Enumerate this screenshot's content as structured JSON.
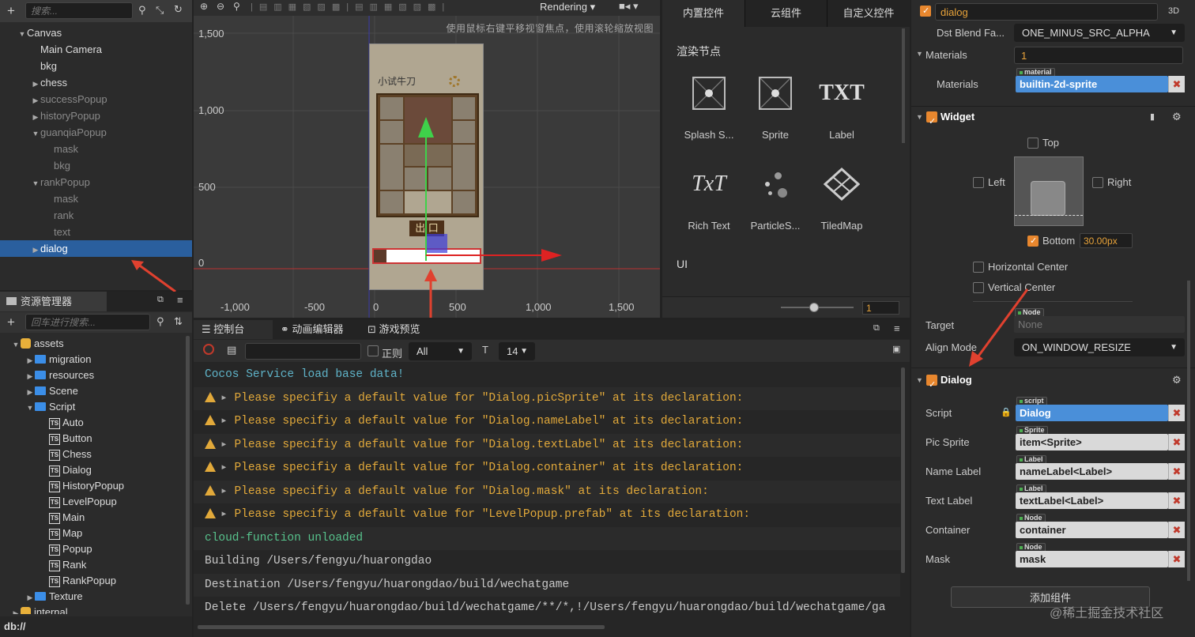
{
  "hierarchy": {
    "search_placeholder": "搜索...",
    "nodes": [
      {
        "label": "Canvas",
        "arrow": "▼",
        "indent": 0,
        "dim": false,
        "sel": false
      },
      {
        "label": "Main Camera",
        "arrow": "",
        "indent": 1,
        "dim": false,
        "sel": false
      },
      {
        "label": "bkg",
        "arrow": "",
        "indent": 1,
        "dim": false,
        "sel": false
      },
      {
        "label": "chess",
        "arrow": "▶",
        "indent": 1,
        "dim": false,
        "sel": false
      },
      {
        "label": "successPopup",
        "arrow": "▶",
        "indent": 1,
        "dim": true,
        "sel": false
      },
      {
        "label": "historyPopup",
        "arrow": "▶",
        "indent": 1,
        "dim": true,
        "sel": false
      },
      {
        "label": "guanqiaPopup",
        "arrow": "▼",
        "indent": 1,
        "dim": true,
        "sel": false
      },
      {
        "label": "mask",
        "arrow": "",
        "indent": 2,
        "dim": true,
        "sel": false
      },
      {
        "label": "bkg",
        "arrow": "",
        "indent": 2,
        "dim": true,
        "sel": false
      },
      {
        "label": "rankPopup",
        "arrow": "▼",
        "indent": 1,
        "dim": true,
        "sel": false
      },
      {
        "label": "mask",
        "arrow": "",
        "indent": 2,
        "dim": true,
        "sel": false
      },
      {
        "label": "rank",
        "arrow": "",
        "indent": 2,
        "dim": true,
        "sel": false
      },
      {
        "label": "text",
        "arrow": "",
        "indent": 2,
        "dim": true,
        "sel": false
      },
      {
        "label": "dialog",
        "arrow": "▶",
        "indent": 1,
        "dim": false,
        "sel": true
      }
    ]
  },
  "assets": {
    "title": "资源管理器",
    "search_placeholder": "回车进行搜索...",
    "items": [
      {
        "label": "assets",
        "kind": "db",
        "arrow": "▼",
        "indent": 0
      },
      {
        "label": "migration",
        "kind": "folder",
        "arrow": "▶",
        "indent": 1
      },
      {
        "label": "resources",
        "kind": "folder",
        "arrow": "▶",
        "indent": 1
      },
      {
        "label": "Scene",
        "kind": "folder",
        "arrow": "▶",
        "indent": 1
      },
      {
        "label": "Script",
        "kind": "folder",
        "arrow": "▼",
        "indent": 1
      },
      {
        "label": "Auto",
        "kind": "ts",
        "arrow": "",
        "indent": 2
      },
      {
        "label": "Button",
        "kind": "ts",
        "arrow": "",
        "indent": 2
      },
      {
        "label": "Chess",
        "kind": "ts",
        "arrow": "",
        "indent": 2
      },
      {
        "label": "Dialog",
        "kind": "ts",
        "arrow": "",
        "indent": 2
      },
      {
        "label": "HistoryPopup",
        "kind": "ts",
        "arrow": "",
        "indent": 2
      },
      {
        "label": "LevelPopup",
        "kind": "ts",
        "arrow": "",
        "indent": 2
      },
      {
        "label": "Main",
        "kind": "ts",
        "arrow": "",
        "indent": 2
      },
      {
        "label": "Map",
        "kind": "ts",
        "arrow": "",
        "indent": 2
      },
      {
        "label": "Popup",
        "kind": "ts",
        "arrow": "",
        "indent": 2
      },
      {
        "label": "Rank",
        "kind": "ts",
        "arrow": "",
        "indent": 2
      },
      {
        "label": "RankPopup",
        "kind": "ts",
        "arrow": "",
        "indent": 2
      },
      {
        "label": "Texture",
        "kind": "folder",
        "arrow": "▶",
        "indent": 1
      },
      {
        "label": "internal",
        "kind": "db",
        "arrow": "▶",
        "indent": 0
      }
    ],
    "status": "db://"
  },
  "scene": {
    "rendering": "Rendering",
    "hint": "使用鼠标右键平移视窗焦点，使用滚轮缩放视图",
    "y_labels": [
      "1,500",
      "1,000",
      "500",
      "0"
    ],
    "x_labels": [
      "-1,000",
      "-500",
      "0",
      "500",
      "1,000",
      "1,500"
    ],
    "game_title": "小试牛刀",
    "exit_label": "出 口"
  },
  "controls": {
    "tabs": [
      "内置控件",
      "云组件",
      "自定义控件"
    ],
    "section": "渲染节点",
    "section2": "UI",
    "items": [
      {
        "label": "Splash S...",
        "icon": "sprite"
      },
      {
        "label": "Sprite",
        "icon": "sprite"
      },
      {
        "label": "Label",
        "icon": "TXT"
      },
      {
        "label": "Rich Text",
        "icon": "TxT"
      },
      {
        "label": "ParticleS...",
        "icon": "particle"
      },
      {
        "label": "TiledMap",
        "icon": "tiled"
      }
    ],
    "zoom_value": "1"
  },
  "console": {
    "tabs": [
      "控制台",
      "动画编辑器",
      "游戏预览"
    ],
    "regex_label": "正则",
    "level": "All",
    "font_size": "14",
    "lines": [
      {
        "type": "info",
        "text": "Cocos Service load base data!"
      },
      {
        "type": "warn",
        "text": "Please specifiy a default value for \"Dialog.picSprite\" at its declaration:"
      },
      {
        "type": "warn",
        "text": "Please specifiy a default value for \"Dialog.nameLabel\" at its declaration:"
      },
      {
        "type": "warn",
        "text": "Please specifiy a default value for \"Dialog.textLabel\" at its declaration:"
      },
      {
        "type": "warn",
        "text": "Please specifiy a default value for \"Dialog.container\" at its declaration:"
      },
      {
        "type": "warn",
        "text": "Please specifiy a default value for \"Dialog.mask\" at its declaration:"
      },
      {
        "type": "warn",
        "text": "Please specifiy a default value for \"LevelPopup.prefab\" at its declaration:"
      },
      {
        "type": "ok",
        "text": "cloud-function unloaded"
      },
      {
        "type": "plain",
        "text": "Building /Users/fengyu/huarongdao"
      },
      {
        "type": "plain",
        "text": "Destination /Users/fengyu/huarongdao/build/wechatgame"
      },
      {
        "type": "plain",
        "text": "Delete /Users/fengyu/huarongdao/build/wechatgame/**/*,!/Users/fengyu/huarongdao/build/wechatgame/ga"
      }
    ]
  },
  "inspector": {
    "node_name": "dialog",
    "badge_3d": "3D",
    "dst_blend_label": "Dst Blend Fa...",
    "dst_blend_value": "ONE_MINUS_SRC_ALPHA",
    "materials_label": "Materials",
    "materials_count": "1",
    "material_item_label": "Materials",
    "material_tag": "material",
    "material_value": "builtin-2d-sprite",
    "widget_title": "Widget",
    "top": "Top",
    "left": "Left",
    "right": "Right",
    "bottom": "Bottom",
    "bottom_value": "30.00px",
    "hcenter": "Horizontal Center",
    "vcenter": "Vertical Center",
    "target_label": "Target",
    "target_tag": "Node",
    "target_value": "None",
    "align_mode_label": "Align Mode",
    "align_mode_value": "ON_WINDOW_RESIZE",
    "dialog_title": "Dialog",
    "props": [
      {
        "label": "Script",
        "tag": "script",
        "value": "Dialog",
        "blue": true
      },
      {
        "label": "Pic Sprite",
        "tag": "Sprite",
        "value": "item<Sprite>",
        "blue": false
      },
      {
        "label": "Name Label",
        "tag": "Label",
        "value": "nameLabel<Label>",
        "blue": false
      },
      {
        "label": "Text Label",
        "tag": "Label",
        "value": "textLabel<Label>",
        "blue": false
      },
      {
        "label": "Container",
        "tag": "Node",
        "value": "container",
        "blue": false
      },
      {
        "label": "Mask",
        "tag": "Node",
        "value": "mask",
        "blue": false
      }
    ],
    "add_component": "添加组件",
    "watermark": "@稀土掘金技术社区"
  }
}
